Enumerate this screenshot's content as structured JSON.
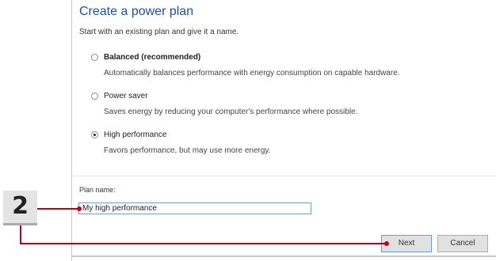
{
  "dialog": {
    "title": "Create a power plan",
    "subtitle": "Start with an existing plan and give it a name."
  },
  "plans": [
    {
      "label": "Balanced (recommended)",
      "description": "Automatically balances performance with energy consumption on capable hardware.",
      "checked": false
    },
    {
      "label": "Power saver",
      "description": "Saves energy by reducing your computer's performance where possible.",
      "checked": false
    },
    {
      "label": "High performance",
      "description": "Favors performance, but may use more energy.",
      "checked": true
    }
  ],
  "plan_name": {
    "label": "Plan name:",
    "value": "My high performance"
  },
  "buttons": {
    "next": "Next",
    "cancel": "Cancel"
  },
  "callout": {
    "number": "2",
    "color": "#c0001a"
  }
}
